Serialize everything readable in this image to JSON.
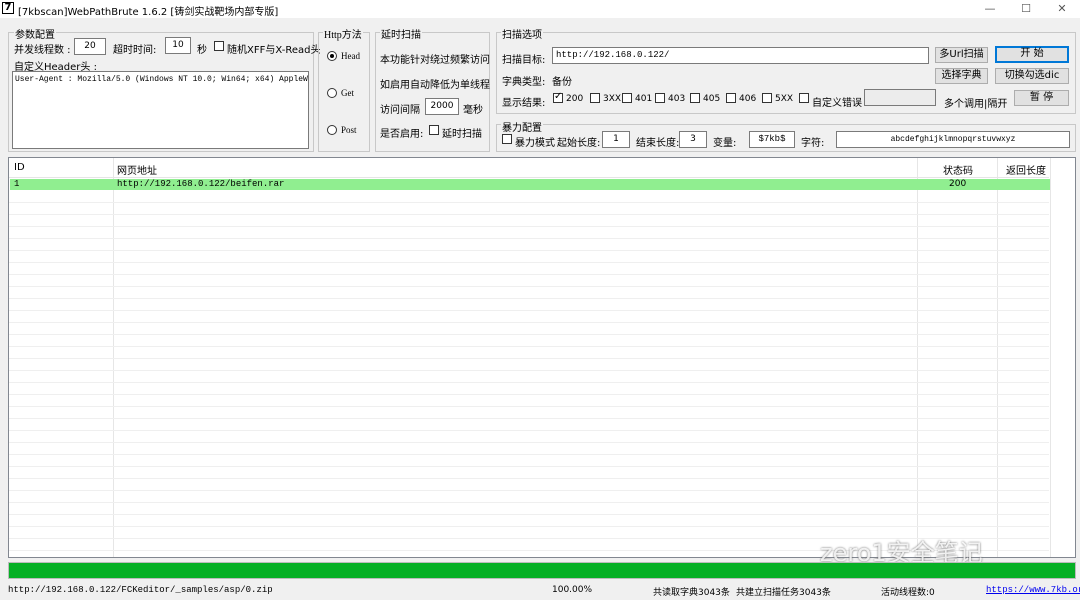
{
  "window": {
    "app_icon": "7",
    "title": "[7kbscan]WebPathBrute 1.6.2 [铸剑实战靶场内部专版]",
    "minimize": "—",
    "maximize": "☐",
    "close": "✕"
  },
  "params": {
    "group_label": "参数配置",
    "threads_label": "并发线程数 :",
    "threads_value": "20",
    "timeout_label": "超时时间:",
    "timeout_value": "10",
    "timeout_unit": "秒",
    "random_xff_label": "随机XFF与X-Read头",
    "header_label": "自定义Header头 :",
    "header_value": "User-Agent : Mozilla/5.0 (Windows NT 10.0; Win64; x64) AppleWebK"
  },
  "http_method": {
    "group_label": "Http方法",
    "options": [
      "Head",
      "Get",
      "Post"
    ],
    "selected": "Head"
  },
  "delay": {
    "group_label": "延时扫描",
    "desc1": "本功能针对绕过频繁访问",
    "desc2": "如启用自动降低为单线程",
    "interval_label": "访问间隔",
    "interval_value": "2000",
    "interval_unit": "毫秒",
    "enable_label": "是否启用:",
    "enable_checkbox": "延时扫描"
  },
  "scan": {
    "group_label": "扫描选项",
    "target_label": "扫描目标:",
    "target_value": "http://192.168.0.122/",
    "multi_url_btn": "多Url扫描",
    "start_btn": "开 始",
    "dict_type_label": "字典类型:",
    "dict_type_value": "备份",
    "choose_dict_btn": "选择字典",
    "switch_dict_btn": "切换勾选dic",
    "result_label": "显示结果:",
    "codes": [
      {
        "label": "200",
        "checked": true
      },
      {
        "label": "3XX",
        "checked": false
      },
      {
        "label": "401",
        "checked": false
      },
      {
        "label": "403",
        "checked": false
      },
      {
        "label": "405",
        "checked": false
      },
      {
        "label": "406",
        "checked": false
      },
      {
        "label": "5XX",
        "checked": false
      }
    ],
    "custom_error_label": "自定义错误",
    "custom_error_value": "",
    "multi_call_label": "多个调用|隔开",
    "pause_btn": "暂 停"
  },
  "brute": {
    "group_label": "暴力配置",
    "mode_label": "暴力模式",
    "start_len_label": "起始长度:",
    "start_len_value": "1",
    "end_len_label": "结束长度:",
    "end_len_value": "3",
    "var_label": "变量:",
    "var_value": "$7kb$",
    "chars_label": "字符:",
    "chars_value": "abcdefghijklmnopqrstuvwxyz"
  },
  "table": {
    "columns": [
      "ID",
      "网页地址",
      "状态码",
      "返回长度"
    ],
    "rows": [
      {
        "id": "1",
        "url": "http://192.168.0.122/beifen.rar",
        "status": "200",
        "length": ""
      }
    ]
  },
  "progress": {
    "percent": 100
  },
  "statusbar": {
    "current_url": "http://192.168.0.122/FCKeditor/_samples/asp/0.zip",
    "percent_text": "100.00%",
    "dict_count": "共读取字典3043条",
    "task_count": "共建立扫描任务3043条",
    "active_threads": "活动线程数:0",
    "link": "https://www.7kb.org"
  },
  "watermark": "zero1安全笔记",
  "colors": {
    "row_highlight": "#90ee90",
    "progress": "#06b025",
    "accent": "#0078d7"
  }
}
